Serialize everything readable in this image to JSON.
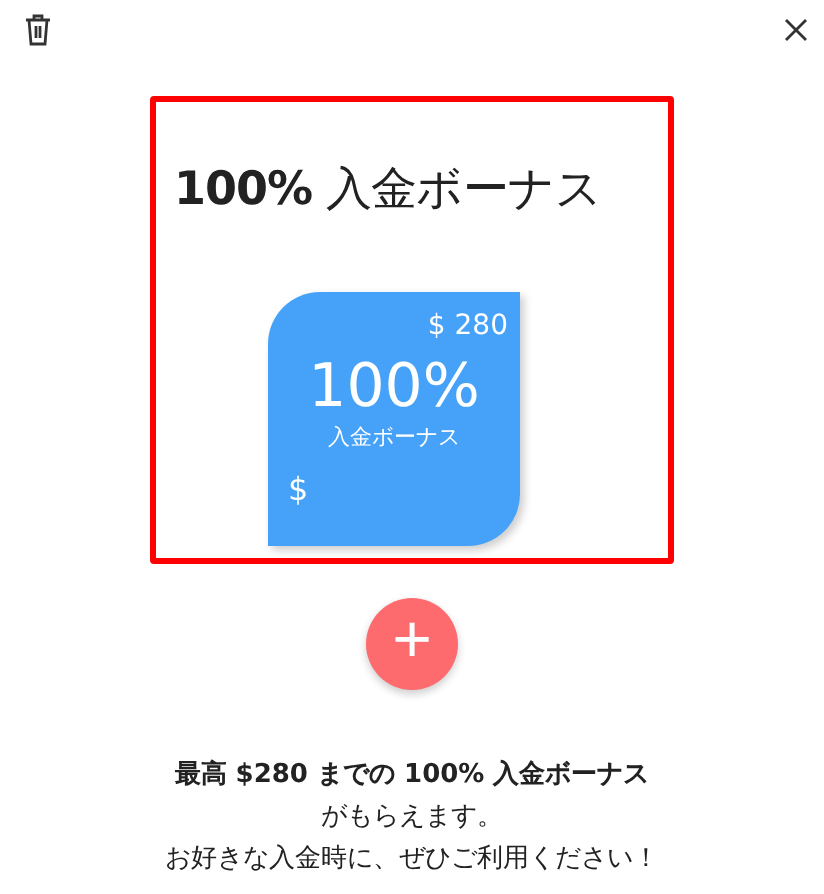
{
  "heading": "**100%** 入金ボーナス",
  "card": {
    "amount": "$ 280",
    "percent": "100%",
    "label": "入金ボーナス",
    "currency": "$"
  },
  "add_button": {
    "label": "+"
  },
  "description": {
    "headline": "最高 $280 までの 100% 入金ボーナス",
    "lines": [
      "がもらえます。",
      "お好きな入金時に、ぜひご利用ください！"
    ]
  }
}
